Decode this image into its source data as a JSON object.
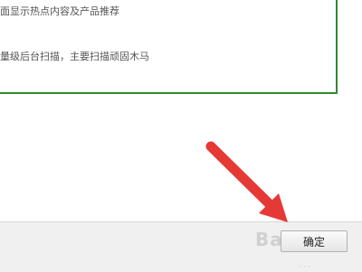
{
  "options": {
    "line1": "面显示热点内容及产品推荐",
    "line2": "量级后台扫描，主要扫描顽固木马"
  },
  "footer": {
    "ok_label": "确定"
  },
  "watermark": "Baidu",
  "colors": {
    "box_border": "#2f8a2f",
    "arrow": "#e53935"
  }
}
